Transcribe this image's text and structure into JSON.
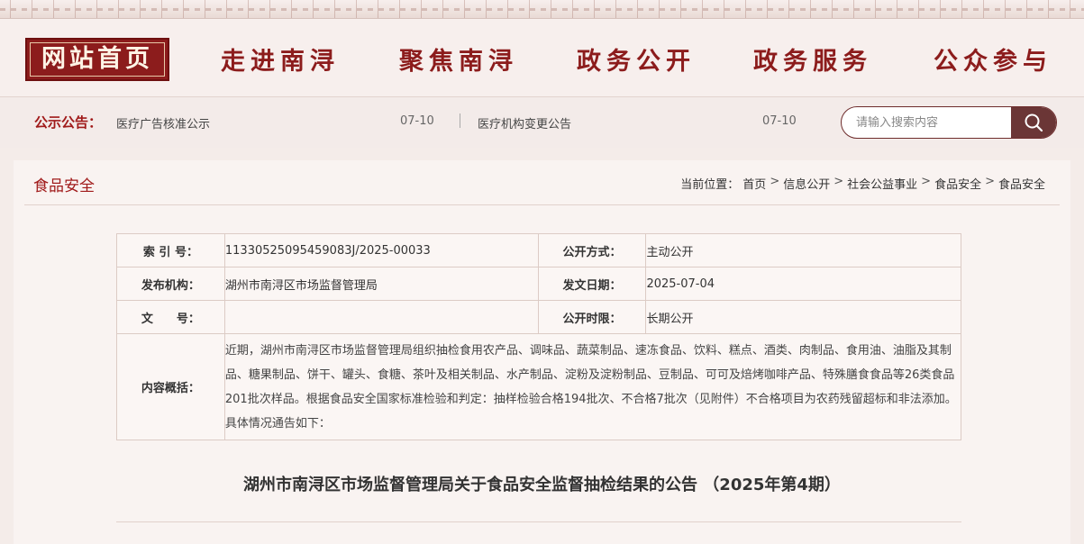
{
  "nav": {
    "home": "网站首页",
    "items": [
      "走进南浔",
      "聚焦南浔",
      "政务公开",
      "政务服务",
      "公众参与"
    ]
  },
  "notice": {
    "title": "公示公告：",
    "items": [
      {
        "text": "医疗广告核准公示",
        "date": "07-10"
      },
      {
        "text": "医疗机构变更公告",
        "date": "07-10"
      }
    ]
  },
  "search": {
    "placeholder": "请输入搜索内容",
    "icon": "search-icon"
  },
  "section": {
    "title": "食品安全",
    "breadcrumb_prefix": "当前位置：",
    "breadcrumb": [
      "首页",
      "信息公开",
      "社会公益事业",
      "食品安全",
      "食品安全"
    ]
  },
  "meta": {
    "index_label": "索 引 号：",
    "index_value": "11330525095459083J/2025-00033",
    "open_method_label": "公开方式：",
    "open_method_value": "主动公开",
    "publisher_label": "发布机构：",
    "publisher_value": "湖州市南浔区市场监督管理局",
    "date_label": "发文日期：",
    "date_value": "2025-07-04",
    "docno_label": "文　　号：",
    "docno_value": "",
    "period_label": "公开时限：",
    "period_value": "长期公开",
    "summary_label": "内容概括：",
    "summary_value": "近期，湖州市南浔区市场监督管理局组织抽检食用农产品、调味品、蔬菜制品、速冻食品、饮料、糕点、酒类、肉制品、食用油、油脂及其制品、糖果制品、饼干、罐头、食糖、茶叶及相关制品、水产制品、淀粉及淀粉制品、豆制品、可可及焙烤咖啡产品、特殊膳食食品等26类食品201批次样品。根据食品安全国家标准检验和判定：抽样检验合格194批次、不合格7批次（见附件）不合格项目为农药残留超标和非法添加。具体情况通告如下："
  },
  "document": {
    "title": "湖州市南浔区市场监督管理局关于食品安全监督抽检结果的公告 （2025年第4期）"
  },
  "colors": {
    "brand": "#8c1c1c",
    "accent": "#a01a1a",
    "search_button": "#6b3636"
  }
}
